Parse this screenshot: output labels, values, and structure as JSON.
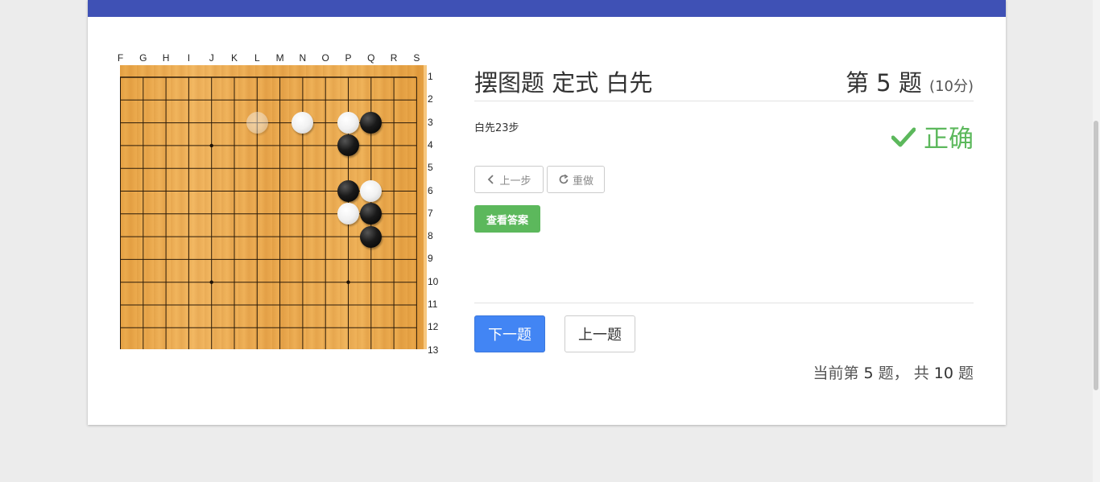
{
  "board": {
    "columns": [
      "F",
      "G",
      "H",
      "I",
      "J",
      "K",
      "L",
      "M",
      "N",
      "O",
      "P",
      "Q",
      "R",
      "S"
    ],
    "rows": [
      "1",
      "2",
      "3",
      "4",
      "5",
      "6",
      "7",
      "8",
      "9",
      "10",
      "11",
      "12",
      "13"
    ],
    "star_points": [
      [
        "J",
        4
      ],
      [
        "J",
        10
      ],
      [
        "P",
        10
      ]
    ],
    "stones": [
      {
        "col": "L",
        "row": 3,
        "color": "white",
        "ghost": true
      },
      {
        "col": "N",
        "row": 3,
        "color": "white"
      },
      {
        "col": "P",
        "row": 3,
        "color": "white"
      },
      {
        "col": "Q",
        "row": 3,
        "color": "black"
      },
      {
        "col": "P",
        "row": 4,
        "color": "black"
      },
      {
        "col": "P",
        "row": 6,
        "color": "black"
      },
      {
        "col": "Q",
        "row": 6,
        "color": "white"
      },
      {
        "col": "P",
        "row": 7,
        "color": "white"
      },
      {
        "col": "Q",
        "row": 7,
        "color": "black"
      },
      {
        "col": "Q",
        "row": 8,
        "color": "black"
      }
    ]
  },
  "problem": {
    "title": "摆图题 定式 白先",
    "number_label": "第 5 题",
    "points_label": "(10分)",
    "description": "白先23步",
    "status_text": "正确",
    "status_color": "#5cb85c"
  },
  "controls": {
    "prev_step_label": "上一步",
    "redo_label": "重做",
    "answer_label": "查看答案",
    "next_question_label": "下一题",
    "prev_question_label": "上一题"
  },
  "progress": {
    "prefix": "当前第",
    "current": "5",
    "middle": "题， 共",
    "total": "10",
    "suffix": "题"
  },
  "colors": {
    "header": "#3f51b5",
    "primary_button": "#4285f4",
    "success": "#5cb85c"
  }
}
